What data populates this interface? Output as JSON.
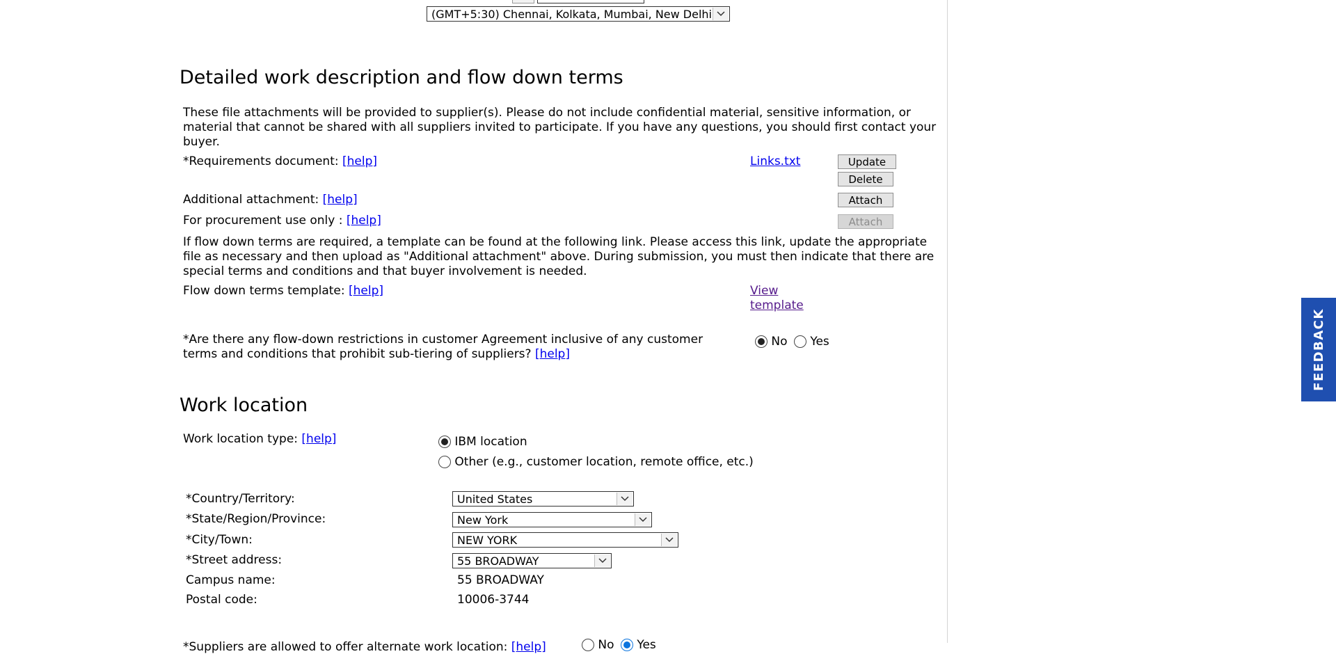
{
  "timezone": {
    "selected": "(GMT+5:30) Chennai, Kolkata, Mumbai, New Delhi"
  },
  "detailed": {
    "title": "Detailed work description and flow down terms",
    "intro": "These file attachments will be provided to supplier(s). Please do not include confidential material, sensitive information, or material that cannot be shared with all suppliers invited to participate. If you have any questions, you should first contact your buyer.",
    "requirements_label": "*Requirements document:",
    "help": "[help]",
    "requirements_file": "Links.txt",
    "update_label": "Update",
    "delete_label": "Delete",
    "additional_label": "Additional attachment:",
    "attach_label": "Attach",
    "procurement_label": "For procurement use only :",
    "flow_text": "If flow down terms are required, a template can be found at the following link. Please access this link, update the appropriate file as necessary and then upload as \"Additional attachment\" above. During submission, you must then indicate that there are special terms and conditions and that buyer involvement is needed.",
    "template_label": "Flow down terms template:",
    "view_template": "View template",
    "restrictions_q": "*Are there any flow-down restrictions in customer Agreement inclusive of any customer terms and conditions that prohibit sub-tiering of suppliers?",
    "opt_no": "No",
    "opt_yes": "Yes",
    "restrictions_selected": "No"
  },
  "work_location": {
    "title": "Work location",
    "type_label": "Work location type:",
    "help": "[help]",
    "type_ibm": "IBM location",
    "type_other": "Other (e.g., customer location, remote office, etc.)",
    "type_selected": "IBM location",
    "country_label": "*Country/Territory:",
    "country_value": "United States",
    "state_label": "*State/Region/Province:",
    "state_value": "New York",
    "city_label": "*City/Town:",
    "city_value": "NEW YORK",
    "street_label": "*Street address:",
    "street_value": "55 BROADWAY",
    "campus_label": "Campus name:",
    "campus_value": "55 BROADWAY",
    "postal_label": "Postal code:",
    "postal_value": "10006-3744",
    "alternate_label": "*Suppliers are allowed to offer alternate work location:",
    "opt_no": "No",
    "opt_yes": "Yes",
    "alternate_selected": "Yes"
  },
  "feedback": {
    "label": "FEEDBACK"
  },
  "colors": {
    "link": "#0000ee",
    "visited_link": "#551a8b",
    "feedback_bg": "#1f4fb0",
    "radio_selected_blue": "#0b74de"
  }
}
